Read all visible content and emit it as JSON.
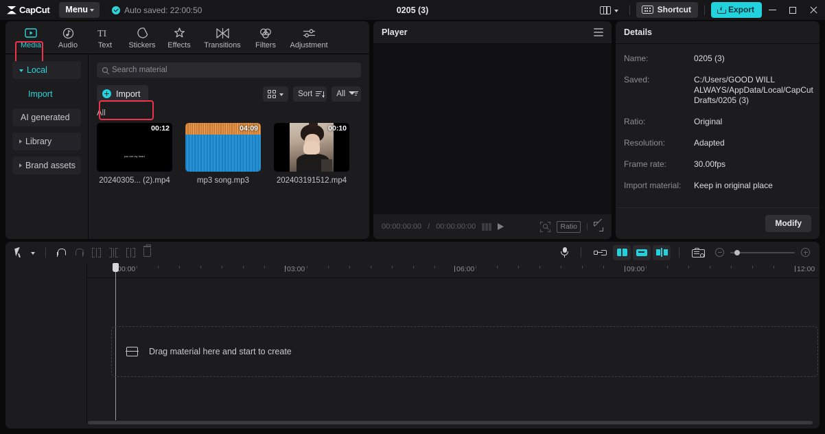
{
  "titlebar": {
    "app_name": "CapCut",
    "menu_label": "Menu",
    "autosave": "Auto saved: 22:00:50",
    "doc_title": "0205 (3)",
    "shortcut_label": "Shortcut",
    "export_label": "Export",
    "accent_color": "#22d3dd",
    "highlight_color": "#f0334d"
  },
  "tabs": [
    {
      "label": "Media",
      "icon": "media-icon",
      "active": true
    },
    {
      "label": "Audio",
      "icon": "audio-icon",
      "active": false
    },
    {
      "label": "Text",
      "icon": "text-icon",
      "active": false
    },
    {
      "label": "Stickers",
      "icon": "stickers-icon",
      "active": false
    },
    {
      "label": "Effects",
      "icon": "effects-icon",
      "active": false
    },
    {
      "label": "Transitions",
      "icon": "transitions-icon",
      "active": false
    },
    {
      "label": "Filters",
      "icon": "filters-icon",
      "active": false
    },
    {
      "label": "Adjustment",
      "icon": "adjustment-icon",
      "active": false
    }
  ],
  "sidebar": {
    "items": [
      {
        "label": "Local",
        "expanded": true
      },
      {
        "label": "Import",
        "sub": true
      },
      {
        "label": "AI generated"
      },
      {
        "label": "Library",
        "expanded": false
      },
      {
        "label": "Brand assets",
        "expanded": false
      }
    ]
  },
  "media": {
    "search_placeholder": "Search material",
    "import_label": "Import",
    "sort_label": "Sort",
    "all_filter_label": "All",
    "section_label": "All",
    "items": [
      {
        "name": "20240305... (2).mp4",
        "duration": "00:12",
        "type": "video",
        "caption": "you are my heart"
      },
      {
        "name": "mp3 song.mp3",
        "duration": "04:09",
        "type": "audio"
      },
      {
        "name": "202403191512.mp4",
        "duration": "00:10",
        "type": "video"
      }
    ]
  },
  "player": {
    "title": "Player",
    "current_time": "00:00:00:00",
    "total_time": "00:00:00:00",
    "time_separator": "/",
    "ratio_label": "Ratio"
  },
  "details": {
    "title": "Details",
    "rows": [
      {
        "key": "Name:",
        "value": "0205 (3)"
      },
      {
        "key": "Saved:",
        "value": "C:/Users/GOOD WILL ALWAYS/AppData/Local/CapCut Drafts/0205 (3)"
      },
      {
        "key": "Ratio:",
        "value": "Original"
      },
      {
        "key": "Resolution:",
        "value": "Adapted"
      },
      {
        "key": "Frame rate:",
        "value": "30.00fps"
      },
      {
        "key": "Import material:",
        "value": "Keep in original place"
      }
    ],
    "modify_label": "Modify"
  },
  "timeline": {
    "ruler_labels": [
      "00:00",
      "03:00",
      "06:00",
      "09:00",
      "12:00"
    ],
    "dropzone_text": "Drag material here and start to create"
  }
}
